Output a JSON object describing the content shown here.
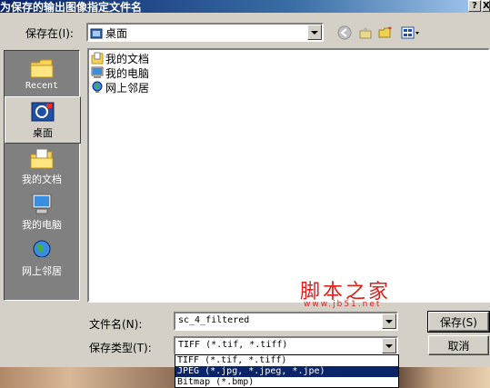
{
  "window": {
    "title": "为保存的输出图像指定文件名",
    "help_btn": "?",
    "close_btn": "X"
  },
  "save_in": {
    "label": "保存在(I):",
    "value": "桌面"
  },
  "places": [
    {
      "label": "Recent",
      "icon": "recent-folder-icon"
    },
    {
      "label": "桌面",
      "icon": "desktop-icon",
      "selected": true
    },
    {
      "label": "我的文档",
      "icon": "my-documents-icon"
    },
    {
      "label": "我的电脑",
      "icon": "my-computer-icon"
    },
    {
      "label": "网上邻居",
      "icon": "network-icon"
    }
  ],
  "files": [
    {
      "name": "我的文档",
      "icon": "my-documents-icon"
    },
    {
      "name": "我的电脑",
      "icon": "my-computer-icon"
    },
    {
      "name": "网上邻居",
      "icon": "network-icon"
    }
  ],
  "filename": {
    "label": "文件名(N):",
    "value": "sc_4_filtered"
  },
  "filetype": {
    "label": "保存类型(T):",
    "value": "TIFF (*.tif, *.tiff)",
    "options": [
      {
        "label": "TIFF (*.tif, *.tiff)",
        "selected": false
      },
      {
        "label": "JPEG (*.jpg, *.jpeg, *.jpe)",
        "selected": true
      },
      {
        "label": "Bitmap (*.bmp)",
        "selected": false
      }
    ]
  },
  "buttons": {
    "save": "保存(S)",
    "cancel": "取消"
  },
  "watermark": {
    "title": "脚本之家",
    "url": "www.jb51.net"
  }
}
